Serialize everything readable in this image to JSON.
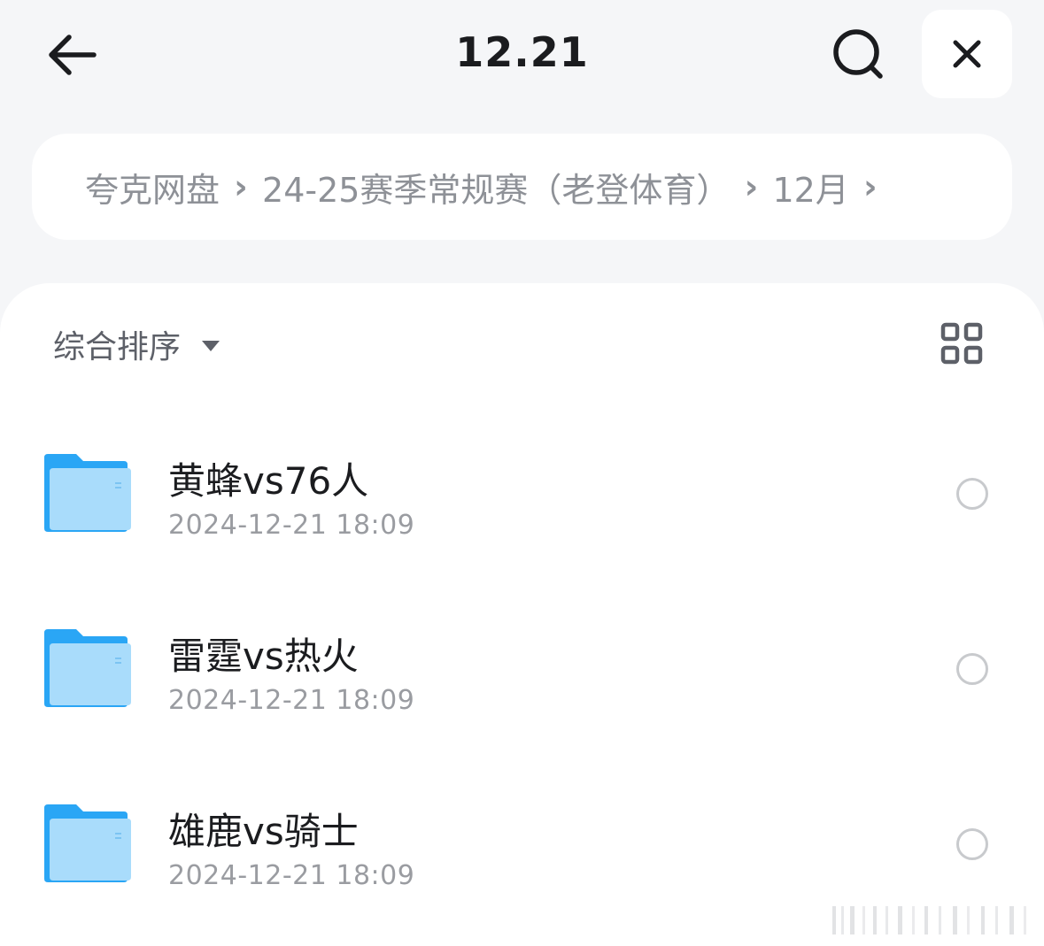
{
  "header": {
    "title": "12.21",
    "back_icon": "arrow-left-icon",
    "search_icon": "search-icon",
    "close_icon": "close-icon"
  },
  "breadcrumb": {
    "items": [
      "夸克网盘",
      "24-25赛季常规赛（老登体育）",
      "12月"
    ],
    "separator": "›"
  },
  "toolbar": {
    "sort_label": "综合排序",
    "sort_icon": "caret-down-icon",
    "view_toggle_icon": "grid-view-icon"
  },
  "files": [
    {
      "name": "黄蜂vs76人",
      "date": "2024-12-21 18:09",
      "icon": "folder-icon"
    },
    {
      "name": "雷霆vs热火",
      "date": "2024-12-21 18:09",
      "icon": "folder-icon"
    },
    {
      "name": "雄鹿vs骑士",
      "date": "2024-12-21 18:09",
      "icon": "folder-icon"
    }
  ],
  "colors": {
    "background": "#f5f6f8",
    "card": "#ffffff",
    "title_text": "#1b1c1f",
    "muted_text": "#8e9197",
    "folder_light": "#a9dcfb",
    "folder_dark": "#2aa6f5"
  }
}
